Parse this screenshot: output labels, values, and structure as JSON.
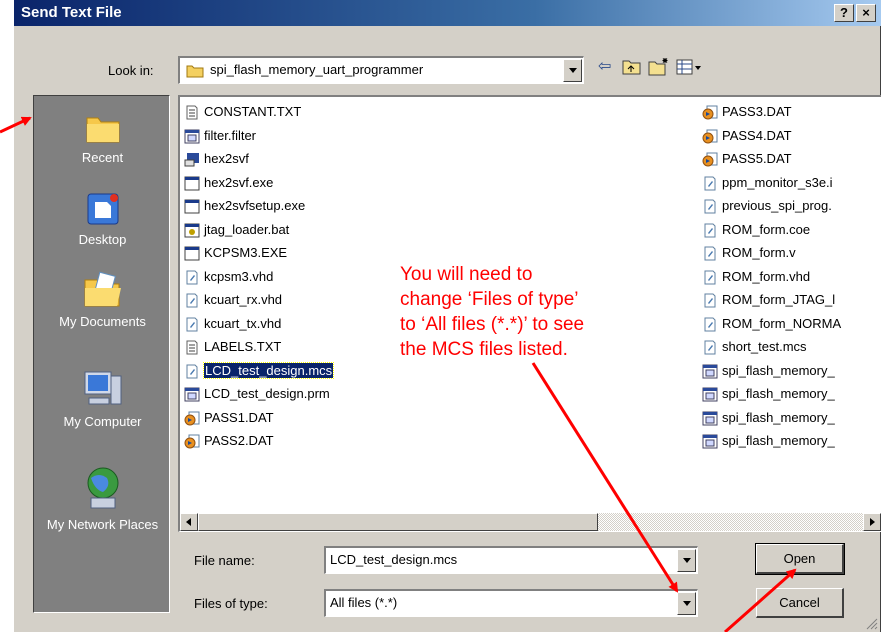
{
  "window": {
    "title": "Send Text File",
    "help_label": "?",
    "close_label": "×"
  },
  "look_in": {
    "label": "Look in:",
    "value": "spi_flash_memory_uart_programmer"
  },
  "places": [
    {
      "label": "Recent",
      "icon": "recent-folder-icon"
    },
    {
      "label": "Desktop",
      "icon": "desktop-icon"
    },
    {
      "label": "My Documents",
      "icon": "my-documents-icon"
    },
    {
      "label": "My Computer",
      "icon": "my-computer-icon"
    },
    {
      "label": "My Network Places",
      "icon": "my-network-places-icon"
    }
  ],
  "files_col1": [
    {
      "name": "CONSTANT.TXT",
      "icon": "text-file-icon"
    },
    {
      "name": "filter.filter",
      "icon": "generic-file-icon"
    },
    {
      "name": "hex2svf",
      "icon": "app-icon"
    },
    {
      "name": "hex2svf.exe",
      "icon": "exe-icon"
    },
    {
      "name": "hex2svfsetup.exe",
      "icon": "exe-icon"
    },
    {
      "name": "jtag_loader.bat",
      "icon": "bat-icon"
    },
    {
      "name": "KCPSM3.EXE",
      "icon": "exe-icon"
    },
    {
      "name": "kcpsm3.vhd",
      "icon": "vhd-file-icon"
    },
    {
      "name": "kcuart_rx.vhd",
      "icon": "vhd-file-icon"
    },
    {
      "name": "kcuart_tx.vhd",
      "icon": "vhd-file-icon"
    },
    {
      "name": "LABELS.TXT",
      "icon": "text-file-icon"
    },
    {
      "name": "LCD_test_design.mcs",
      "icon": "vhd-file-icon",
      "selected": true
    },
    {
      "name": "LCD_test_design.prm",
      "icon": "generic-file-icon"
    },
    {
      "name": "PASS1.DAT",
      "icon": "dat-file-icon"
    },
    {
      "name": "PASS2.DAT",
      "icon": "dat-file-icon"
    }
  ],
  "files_col2": [
    {
      "name": "PASS3.DAT",
      "icon": "dat-file-icon"
    },
    {
      "name": "PASS4.DAT",
      "icon": "dat-file-icon"
    },
    {
      "name": "PASS5.DAT",
      "icon": "dat-file-icon"
    },
    {
      "name": "ppm_monitor_s3e.i",
      "icon": "vhd-file-icon"
    },
    {
      "name": "previous_spi_prog.",
      "icon": "vhd-file-icon"
    },
    {
      "name": "ROM_form.coe",
      "icon": "vhd-file-icon"
    },
    {
      "name": "ROM_form.v",
      "icon": "vhd-file-icon"
    },
    {
      "name": "ROM_form.vhd",
      "icon": "vhd-file-icon"
    },
    {
      "name": "ROM_form_JTAG_l",
      "icon": "vhd-file-icon"
    },
    {
      "name": "ROM_form_NORMA",
      "icon": "vhd-file-icon"
    },
    {
      "name": "short_test.mcs",
      "icon": "vhd-file-icon"
    },
    {
      "name": "spi_flash_memory_",
      "icon": "generic-file-icon"
    },
    {
      "name": "spi_flash_memory_",
      "icon": "generic-file-icon"
    },
    {
      "name": "spi_flash_memory_",
      "icon": "generic-file-icon"
    },
    {
      "name": "spi_flash_memory_",
      "icon": "generic-file-icon"
    }
  ],
  "file_name": {
    "label": "File name:",
    "value": "LCD_test_design.mcs"
  },
  "files_of_type": {
    "label": "Files of type:",
    "value": "All files (*.*)"
  },
  "buttons": {
    "open": "Open",
    "cancel": "Cancel"
  },
  "annotation": {
    "lines": [
      "You will need to",
      "change ‘Files of type’",
      "to ‘All files (*.*)’ to see",
      "the MCS files listed."
    ],
    "color": "#ff0000"
  }
}
